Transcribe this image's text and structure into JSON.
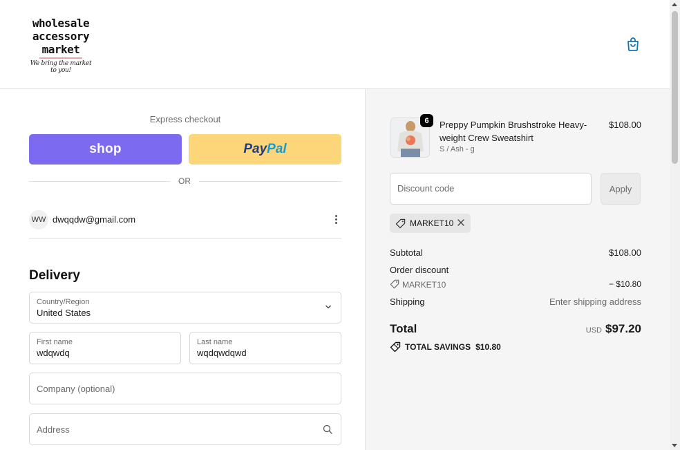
{
  "header": {
    "logo": {
      "line1": "wholesale",
      "line2": "accessory",
      "line3": "market",
      "tagline": "We bring the market to you!"
    },
    "cart_icon": "shopping-bag-icon",
    "accent_color": "#1773b0"
  },
  "checkout": {
    "express_label": "Express checkout",
    "shop_button": "shop",
    "paypal_pay": "Pay",
    "paypal_pal": "Pal",
    "or_label": "OR",
    "account": {
      "initials": "WW",
      "email": "dwqqdw@gmail.com"
    },
    "delivery_heading": "Delivery",
    "country": {
      "label": "Country/Region",
      "value": "United States"
    },
    "first_name": {
      "label": "First name",
      "value": "wdqwdq"
    },
    "last_name": {
      "label": "Last name",
      "value": "wqdqwdqwd"
    },
    "company": {
      "placeholder": "Company (optional)"
    },
    "address": {
      "placeholder": "Address"
    }
  },
  "summary": {
    "product": {
      "quantity": "6",
      "name": "Preppy Pumpkin Brushstroke Heavy-weight Crew Sweatshirt",
      "variant": "S / Ash - g",
      "price": "$108.00"
    },
    "discount": {
      "placeholder": "Discount code",
      "apply_label": "Apply",
      "applied_code": "MARKET10"
    },
    "subtotal_label": "Subtotal",
    "subtotal_value": "$108.00",
    "order_discount_label": "Order discount",
    "order_discount_code": "MARKET10",
    "order_discount_value": "− $10.80",
    "shipping_label": "Shipping",
    "shipping_value": "Enter shipping address",
    "total_label": "Total",
    "total_currency": "USD",
    "total_value": "$97.20",
    "savings_label": "TOTAL SAVINGS",
    "savings_value": "$10.80"
  },
  "colors": {
    "shop_purple": "#7c6bf0",
    "paypal_yellow": "#fcd678",
    "summary_bg": "#f5f5f5"
  }
}
